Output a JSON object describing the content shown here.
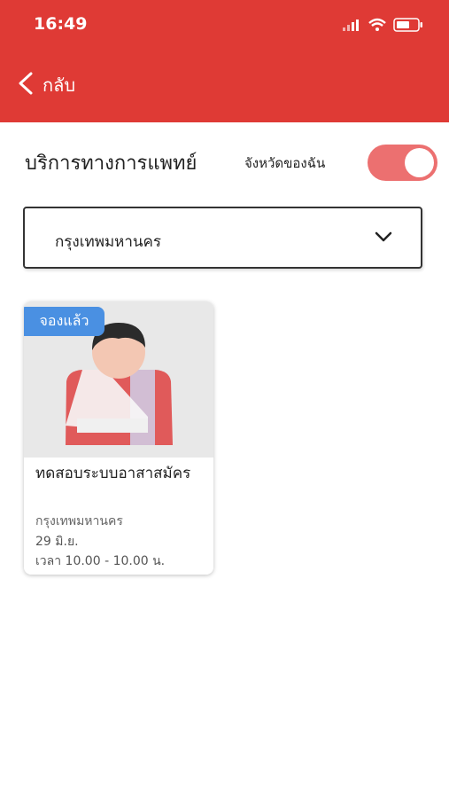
{
  "status_bar": {
    "time": "16:49"
  },
  "header": {
    "back_label": "กลับ",
    "accent_color": "#df3a35"
  },
  "page": {
    "title": "บริการทางการแพทย์",
    "toggle_label": "จังหวัดของฉัน",
    "toggle_on": true
  },
  "filter": {
    "selected_province": "กรุงเทพมหานคร"
  },
  "cards": [
    {
      "badge": "จองแล้ว",
      "title": "ทดสอบระบบอาสาสมัคร",
      "location": "กรุงเทพมหานคร",
      "date": "29 มิ.ย.",
      "time": "เวลา 10.00 - 10.00 น."
    }
  ]
}
